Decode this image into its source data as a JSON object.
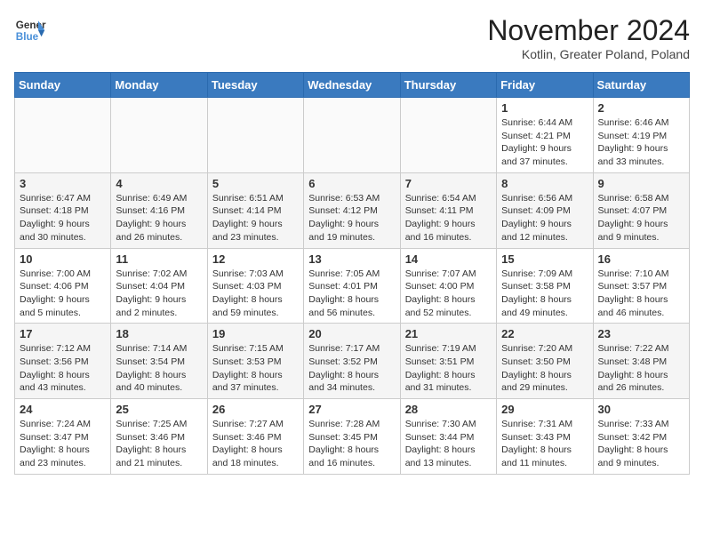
{
  "header": {
    "logo_line1": "General",
    "logo_line2": "Blue",
    "month_year": "November 2024",
    "location": "Kotlin, Greater Poland, Poland"
  },
  "days_of_week": [
    "Sunday",
    "Monday",
    "Tuesday",
    "Wednesday",
    "Thursday",
    "Friday",
    "Saturday"
  ],
  "weeks": [
    [
      {
        "day": "",
        "info": ""
      },
      {
        "day": "",
        "info": ""
      },
      {
        "day": "",
        "info": ""
      },
      {
        "day": "",
        "info": ""
      },
      {
        "day": "",
        "info": ""
      },
      {
        "day": "1",
        "info": "Sunrise: 6:44 AM\nSunset: 4:21 PM\nDaylight: 9 hours\nand 37 minutes."
      },
      {
        "day": "2",
        "info": "Sunrise: 6:46 AM\nSunset: 4:19 PM\nDaylight: 9 hours\nand 33 minutes."
      }
    ],
    [
      {
        "day": "3",
        "info": "Sunrise: 6:47 AM\nSunset: 4:18 PM\nDaylight: 9 hours\nand 30 minutes."
      },
      {
        "day": "4",
        "info": "Sunrise: 6:49 AM\nSunset: 4:16 PM\nDaylight: 9 hours\nand 26 minutes."
      },
      {
        "day": "5",
        "info": "Sunrise: 6:51 AM\nSunset: 4:14 PM\nDaylight: 9 hours\nand 23 minutes."
      },
      {
        "day": "6",
        "info": "Sunrise: 6:53 AM\nSunset: 4:12 PM\nDaylight: 9 hours\nand 19 minutes."
      },
      {
        "day": "7",
        "info": "Sunrise: 6:54 AM\nSunset: 4:11 PM\nDaylight: 9 hours\nand 16 minutes."
      },
      {
        "day": "8",
        "info": "Sunrise: 6:56 AM\nSunset: 4:09 PM\nDaylight: 9 hours\nand 12 minutes."
      },
      {
        "day": "9",
        "info": "Sunrise: 6:58 AM\nSunset: 4:07 PM\nDaylight: 9 hours\nand 9 minutes."
      }
    ],
    [
      {
        "day": "10",
        "info": "Sunrise: 7:00 AM\nSunset: 4:06 PM\nDaylight: 9 hours\nand 5 minutes."
      },
      {
        "day": "11",
        "info": "Sunrise: 7:02 AM\nSunset: 4:04 PM\nDaylight: 9 hours\nand 2 minutes."
      },
      {
        "day": "12",
        "info": "Sunrise: 7:03 AM\nSunset: 4:03 PM\nDaylight: 8 hours\nand 59 minutes."
      },
      {
        "day": "13",
        "info": "Sunrise: 7:05 AM\nSunset: 4:01 PM\nDaylight: 8 hours\nand 56 minutes."
      },
      {
        "day": "14",
        "info": "Sunrise: 7:07 AM\nSunset: 4:00 PM\nDaylight: 8 hours\nand 52 minutes."
      },
      {
        "day": "15",
        "info": "Sunrise: 7:09 AM\nSunset: 3:58 PM\nDaylight: 8 hours\nand 49 minutes."
      },
      {
        "day": "16",
        "info": "Sunrise: 7:10 AM\nSunset: 3:57 PM\nDaylight: 8 hours\nand 46 minutes."
      }
    ],
    [
      {
        "day": "17",
        "info": "Sunrise: 7:12 AM\nSunset: 3:56 PM\nDaylight: 8 hours\nand 43 minutes."
      },
      {
        "day": "18",
        "info": "Sunrise: 7:14 AM\nSunset: 3:54 PM\nDaylight: 8 hours\nand 40 minutes."
      },
      {
        "day": "19",
        "info": "Sunrise: 7:15 AM\nSunset: 3:53 PM\nDaylight: 8 hours\nand 37 minutes."
      },
      {
        "day": "20",
        "info": "Sunrise: 7:17 AM\nSunset: 3:52 PM\nDaylight: 8 hours\nand 34 minutes."
      },
      {
        "day": "21",
        "info": "Sunrise: 7:19 AM\nSunset: 3:51 PM\nDaylight: 8 hours\nand 31 minutes."
      },
      {
        "day": "22",
        "info": "Sunrise: 7:20 AM\nSunset: 3:50 PM\nDaylight: 8 hours\nand 29 minutes."
      },
      {
        "day": "23",
        "info": "Sunrise: 7:22 AM\nSunset: 3:48 PM\nDaylight: 8 hours\nand 26 minutes."
      }
    ],
    [
      {
        "day": "24",
        "info": "Sunrise: 7:24 AM\nSunset: 3:47 PM\nDaylight: 8 hours\nand 23 minutes."
      },
      {
        "day": "25",
        "info": "Sunrise: 7:25 AM\nSunset: 3:46 PM\nDaylight: 8 hours\nand 21 minutes."
      },
      {
        "day": "26",
        "info": "Sunrise: 7:27 AM\nSunset: 3:46 PM\nDaylight: 8 hours\nand 18 minutes."
      },
      {
        "day": "27",
        "info": "Sunrise: 7:28 AM\nSunset: 3:45 PM\nDaylight: 8 hours\nand 16 minutes."
      },
      {
        "day": "28",
        "info": "Sunrise: 7:30 AM\nSunset: 3:44 PM\nDaylight: 8 hours\nand 13 minutes."
      },
      {
        "day": "29",
        "info": "Sunrise: 7:31 AM\nSunset: 3:43 PM\nDaylight: 8 hours\nand 11 minutes."
      },
      {
        "day": "30",
        "info": "Sunrise: 7:33 AM\nSunset: 3:42 PM\nDaylight: 8 hours\nand 9 minutes."
      }
    ]
  ]
}
